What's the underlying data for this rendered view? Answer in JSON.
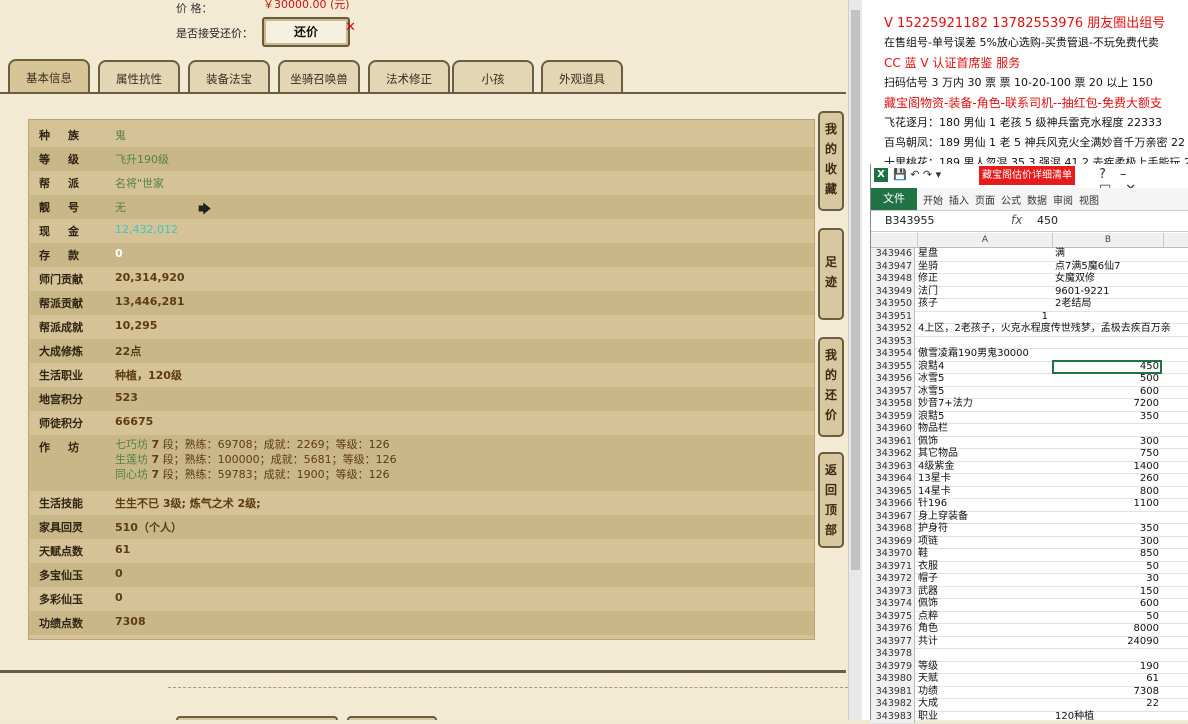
{
  "top": {
    "price_label": "价      格：",
    "price_value": "￥30000.00 (元)",
    "bargain_label": "是否接受还价：",
    "bargain_button": "还价",
    "bargain_mark": "✕"
  },
  "tabs": [
    "基本信息",
    "属性抗性",
    "装备法宝",
    "坐骑召唤兽",
    "法术修正",
    "小孩",
    "外观道具"
  ],
  "info_rows": [
    {
      "label": "种族",
      "value": "鬼"
    },
    {
      "label": "等级",
      "value": "飞升190级"
    },
    {
      "label": "帮派",
      "value": "名将\"世家"
    },
    {
      "label": "靓号",
      "value": "无"
    },
    {
      "label": "现金",
      "value": "12,432,012"
    },
    {
      "label": "存款",
      "value": "0"
    },
    {
      "label": "师门贡献",
      "value": "20,314,920"
    },
    {
      "label": "帮派贡献",
      "value": "13,446,281"
    },
    {
      "label": "帮派成就",
      "value": "10,295"
    },
    {
      "label": "大成修炼",
      "value": "22点"
    },
    {
      "label": "生活职业",
      "value": "种植，120级"
    },
    {
      "label": "地宫积分",
      "value": "523"
    },
    {
      "label": "师徒积分",
      "value": "66675"
    }
  ],
  "workshop": {
    "label": "作坊",
    "lines": [
      {
        "name": "七巧坊",
        "level": "7",
        "rest": "段；熟练：69708；成就：2269；等级：126"
      },
      {
        "name": "生莲坊",
        "level": "7",
        "rest": "段；熟练：100000；成就：5681；等级：126"
      },
      {
        "name": "同心坊",
        "level": "7",
        "rest": "段；熟练：59783；成就：1900；等级：126"
      }
    ]
  },
  "info_rows2": [
    {
      "label": "生活技能",
      "value": "生生不已 3级; 炼气之术 2级;"
    },
    {
      "label": "家具回灵",
      "value": "510（个人）"
    },
    {
      "label": "天赋点数",
      "value": "61"
    },
    {
      "label": "多宝仙玉",
      "value": "0"
    },
    {
      "label": "多彩仙玉",
      "value": "0"
    },
    {
      "label": "功绩点数",
      "value": "7308"
    }
  ],
  "side_buttons": [
    "我的收藏",
    "足迹",
    "我的还价",
    "返回顶部"
  ],
  "right_text": [
    "V 15225921182   13782553976 朋友圈出组号",
    "在售组号-单号误差 5%放心选购-买贵管退-不玩免费代卖",
    "CC 蓝 V 认证首席鉴        服务",
    "扫码估号 3 万内 30 票      票    10-20-100 票 20 以上 150",
    "藏宝阁物资-装备-角色-联系司机--抽红包-免费大额支",
    "飞花逐月：180 男仙 1 老孩 5 级神兵雷克水程度 22333",
    "百鸟朝凤：189 男仙 1 老 5 神兵风克火全满妙音千万亲密 22",
    "十里桃花：189 男人忽混 35.3 强混 41.2 去疾柔极上手能玩 2"
  ],
  "excel": {
    "window_title": "藏宝阁估价详细清单 - E",
    "ribbon_file": "文件",
    "ribbon_tabs": [
      "开始",
      "插入",
      "页面",
      "公式",
      "数据",
      "审阅",
      "视图"
    ],
    "name_box": "B343955",
    "fx": "fx",
    "formula_value": "450",
    "col_a": "A",
    "col_b": "B",
    "rows": [
      {
        "n": "343946",
        "a": "星盘",
        "b": "满"
      },
      {
        "n": "343947",
        "a": "坐骑",
        "b": "点7满5魔6仙7"
      },
      {
        "n": "343948",
        "a": "修正",
        "b": "女魔双修"
      },
      {
        "n": "343949",
        "a": "法门",
        "b": "9601-9221"
      },
      {
        "n": "343950",
        "a": "孩子",
        "b": "2老结局"
      },
      {
        "n": "343951",
        "a": "1",
        "b": ""
      },
      {
        "n": "343952",
        "a": "4上区，2老孩子，火克水程度传世残梦，孟极去疾百万亲",
        "b": ""
      },
      {
        "n": "343953",
        "a": "",
        "b": ""
      },
      {
        "n": "343954",
        "a": "傲雪凌霜190男鬼30000",
        "b": ""
      },
      {
        "n": "343955",
        "a": "浪黠4",
        "b": "450"
      },
      {
        "n": "343956",
        "a": "冰雪5",
        "b": "500"
      },
      {
        "n": "343957",
        "a": "冰雪5",
        "b": "600"
      },
      {
        "n": "343958",
        "a": "妙音7+法力",
        "b": "7200"
      },
      {
        "n": "343959",
        "a": "浪黠5",
        "b": "350"
      },
      {
        "n": "343960",
        "a": "物品栏",
        "b": ""
      },
      {
        "n": "343961",
        "a": "佩饰",
        "b": "300"
      },
      {
        "n": "343962",
        "a": "其它物品",
        "b": "750"
      },
      {
        "n": "343963",
        "a": "4级紫金",
        "b": "1400"
      },
      {
        "n": "343964",
        "a": "13星卡",
        "b": "260"
      },
      {
        "n": "343965",
        "a": "14星卡",
        "b": "800"
      },
      {
        "n": "343966",
        "a": "针196",
        "b": "1100"
      },
      {
        "n": "343967",
        "a": "身上穿装备",
        "b": ""
      },
      {
        "n": "343968",
        "a": "护身符",
        "b": "350"
      },
      {
        "n": "343969",
        "a": "项链",
        "b": "300"
      },
      {
        "n": "343970",
        "a": "鞋",
        "b": "850"
      },
      {
        "n": "343971",
        "a": "衣服",
        "b": "50"
      },
      {
        "n": "343972",
        "a": "帽子",
        "b": "30"
      },
      {
        "n": "343973",
        "a": "武器",
        "b": "150"
      },
      {
        "n": "343974",
        "a": "佩饰",
        "b": "600"
      },
      {
        "n": "343975",
        "a": "点粹",
        "b": "50"
      },
      {
        "n": "343976",
        "a": "角色",
        "b": "8000"
      },
      {
        "n": "343977",
        "a": "共计",
        "b": "24090"
      },
      {
        "n": "343978",
        "a": "",
        "b": ""
      },
      {
        "n": "343979",
        "a": "等级",
        "b": "190"
      },
      {
        "n": "343980",
        "a": "天赋",
        "b": "61"
      },
      {
        "n": "343981",
        "a": "功绩",
        "b": "7308"
      },
      {
        "n": "343982",
        "a": "大成",
        "b": "22"
      },
      {
        "n": "343983",
        "a": "职业",
        "b": "120种植"
      }
    ]
  }
}
